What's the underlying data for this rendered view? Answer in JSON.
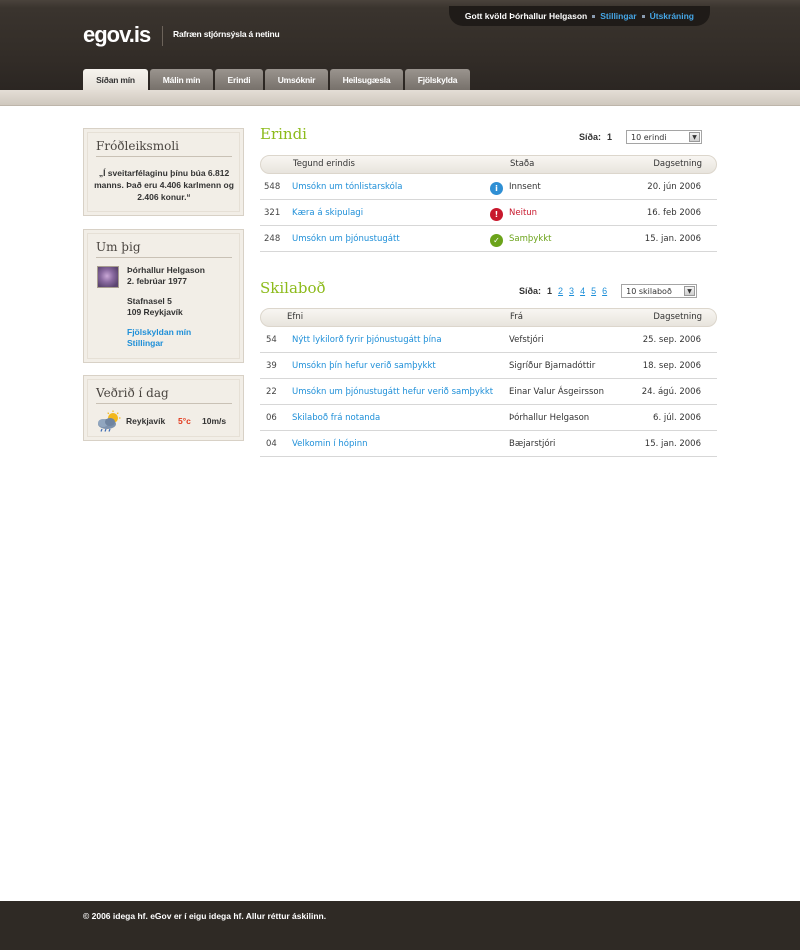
{
  "header": {
    "greeting": "Gott kvöld Þórhallur Helgason",
    "settings_link": "Stillingar",
    "logout_link": "Útskráning",
    "logo": "egov.is",
    "tagline": "Rafræn stjórnsýsla á netinu"
  },
  "tabs": [
    {
      "label": "Síðan mín",
      "active": true
    },
    {
      "label": "Málin mín",
      "active": false
    },
    {
      "label": "Erindi",
      "active": false
    },
    {
      "label": "Umsóknir",
      "active": false
    },
    {
      "label": "Heilsugæsla",
      "active": false
    },
    {
      "label": "Fjölskylda",
      "active": false
    }
  ],
  "sidebar": {
    "fact": {
      "title": "Fróðleiksmoli",
      "text": "„Í sveitarfélaginu þínu búa 6.812 manns. Það eru 4.406 karlmenn og 2.406 konur.“"
    },
    "about": {
      "title": "Um þig",
      "name": "Þórhallur Helgason",
      "birthdate": "2. febrúar 1977",
      "street": "Stafnasel 5",
      "city": "109 Reykjavík",
      "family_link": "Fjölskyldan mín",
      "settings_link": "Stillingar"
    },
    "weather": {
      "title": "Veðrið í dag",
      "icon": "partly-cloudy-rain-icon",
      "city": "Reykjavík",
      "temp": "5°c",
      "wind": "10m/s"
    }
  },
  "errands": {
    "title": "Erindi",
    "page_label": "Síða:",
    "pages": [
      "1"
    ],
    "select_value": "10 erindi",
    "headers": {
      "type": "Tegund erindis",
      "status": "Staða",
      "date": "Dagsetning"
    },
    "rows": [
      {
        "num": "548",
        "type": "Umsókn um tónlistarskóla",
        "status": "Innsent",
        "status_kind": "info",
        "date": "20. jún 2006"
      },
      {
        "num": "321",
        "type": "Kæra á skipulagi",
        "status": "Neitun",
        "status_kind": "denied",
        "date": "16. feb 2006"
      },
      {
        "num": "248",
        "type": "Umsókn um þjónustugátt",
        "status": "Samþykkt",
        "status_kind": "approved",
        "date": "15. jan. 2006"
      }
    ],
    "status_colors": {
      "info": "#2f8fd4",
      "denied": "#c8182d",
      "approved": "#6ba31a"
    }
  },
  "messages": {
    "title": "Skilaboð",
    "page_label": "Síða:",
    "current_page": "1",
    "pages": [
      "2",
      "3",
      "4",
      "5",
      "6"
    ],
    "select_value": "10 skilaboð",
    "headers": {
      "subject": "Efni",
      "from": "Frá",
      "date": "Dagsetning"
    },
    "rows": [
      {
        "num": "54",
        "subject": "Nýtt lykilorð fyrir þjónustugátt þína",
        "from": "Vefstjóri",
        "date": "25. sep. 2006"
      },
      {
        "num": "39",
        "subject": "Umsókn þín hefur verið samþykkt",
        "from": "Sigríður Bjarnadóttir",
        "date": "18. sep. 2006"
      },
      {
        "num": "22",
        "subject": "Umsókn um þjónustugátt hefur verið samþykkt",
        "from": "Einar Valur Ásgeirsson",
        "date": "24. ágú. 2006"
      },
      {
        "num": "06",
        "subject": "Skilaboð frá notanda",
        "from": "Þórhallur Helgason",
        "date": "6. júl. 2006"
      },
      {
        "num": "04",
        "subject": "Velkomin í hópinn",
        "from": "Bæjarstjóri",
        "date": "15. jan. 2006"
      }
    ]
  },
  "footer": {
    "text": "© 2006 idega hf. eGov er í eigu idega hf. Allur réttur áskilinn."
  }
}
